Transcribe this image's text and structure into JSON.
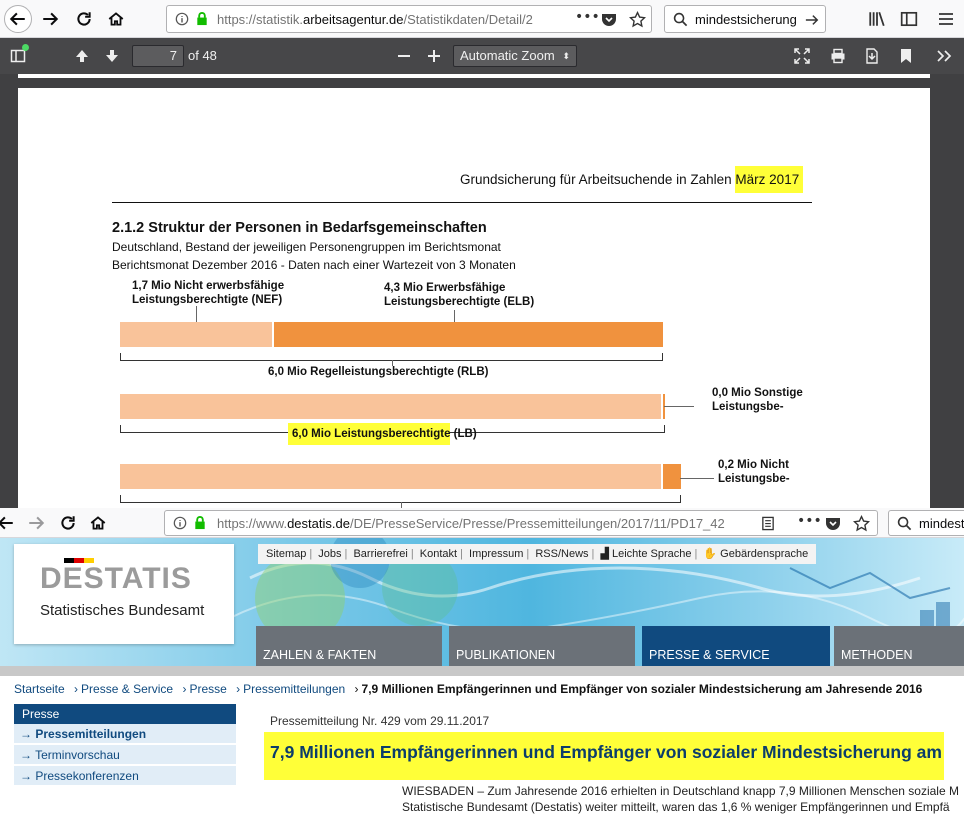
{
  "browser1": {
    "url_prefix": "https://statistik.",
    "url_domain": "arbeitsagentur.de",
    "url_path": "/Statistikdaten/Detail/2",
    "search_text": "mindestsicherung"
  },
  "pdf_toolbar": {
    "page_number": "7",
    "page_count": "of 48",
    "zoom": "Automatic Zoom"
  },
  "pdf": {
    "header": "Grundsicherung für Arbeitsuchende in Zahlen ",
    "header_highlight": "März 2017",
    "section_title": "2.1.2 Struktur der Personen in Bedarfsgemeinschaften",
    "subtitle1": "Deutschland, Bestand der jeweiligen Personengruppen im Berichtsmonat",
    "subtitle2": "Berichtsmonat Dezember 2016 -  Daten nach einer Wartezeit von 3 Monaten",
    "label_nef_1": "1,7 Mio Nicht erwerbsfähige",
    "label_nef_2": "Leistungsberechtigte (NEF)",
    "label_elb_1": "4,3 Mio Erwerbsfähige",
    "label_elb_2": "Leistungsberechtigte (ELB)",
    "label_rlb": "6,0 Mio Regelleistungsberechtigte (RLB)",
    "label_sonst_1": "0,0 Mio Sonstige",
    "label_sonst_2": "Leistungsbe-",
    "label_lb_highlight": "6,0 Mio Leistungsberechtigte",
    "label_lb_rest": " (LB)",
    "label_nicht_1": "0,2 Mio Nicht",
    "label_nicht_2": "Leistungsbe-"
  },
  "chart_data": [
    {
      "type": "bar",
      "title": "2.1.2 Struktur der Personen in Bedarfsgemeinschaften",
      "orientation": "horizontal-stacked",
      "rows": [
        {
          "label": "6,0 Mio Regelleistungsberechtigte (RLB)",
          "segments": [
            {
              "name": "Nicht erwerbsfähige Leistungsberechtigte (NEF)",
              "value": 1.7,
              "color": "#f9c39a"
            },
            {
              "name": "Erwerbsfähige Leistungsberechtigte (ELB)",
              "value": 4.3,
              "color": "#f0923e"
            }
          ]
        },
        {
          "label": "6,0 Mio Leistungsberechtigte (LB)",
          "segments": [
            {
              "name": "Regelleistungsberechtigte (RLB)",
              "value": 6.0,
              "color": "#f9c39a"
            },
            {
              "name": "Sonstige Leistungsberechtigte",
              "value": 0.0,
              "color": "#f0923e"
            }
          ]
        },
        {
          "label": "",
          "segments": [
            {
              "name": "Leistungsberechtigte (LB)",
              "value": 6.0,
              "color": "#f9c39a"
            },
            {
              "name": "Nicht Leistungsberechtigte",
              "value": 0.2,
              "color": "#f0923e"
            }
          ]
        }
      ],
      "unit": "Mio"
    }
  ],
  "browser2": {
    "url_prefix": "https://www.",
    "url_domain": "destatis.de",
    "url_path": "/DE/PresseService/Presse/Pressemitteilungen/2017/11/PD17_42",
    "search_text": "mindest"
  },
  "destatis": {
    "logo_main": "DESTATIS",
    "logo_sub": "Statistisches Bundesamt",
    "topnav": [
      "Sitemap",
      "Jobs",
      "Barrierefrei",
      "Kontakt",
      "Impressum",
      "RSS/News",
      "Leichte Sprache",
      "Gebärdensprache"
    ],
    "tabs": [
      "ZAHLEN & FAKTEN",
      "PUBLIKATIONEN",
      "PRESSE & SERVICE",
      "METHODEN"
    ],
    "breadcrumb": [
      "Startseite",
      "Presse & Service",
      "Presse",
      "Pressemitteilungen"
    ],
    "breadcrumb_current": "7,9 Millionen Empfängerinnen und Empfänger von sozialer Mindestsicherung am Jahresende 2016",
    "sidebar_head": "Presse",
    "sidebar_items": [
      "Pressemitteilungen",
      "Terminvorschau",
      "Pressekonferenzen"
    ],
    "pm_number": "Pressemitteilung Nr. 429 vom 29.11.2017",
    "headline": "7,9 Millionen Empfängerinnen und Empfänger von sozialer Mindestsicherung am",
    "lead1": "WIESBADEN – Zum Jahresende 2016 erhielten in Deutschland knapp 7,9 Millionen Menschen soziale M",
    "lead2": "Statistische Bundesamt (Destatis) weiter mitteilt, waren das 1,6 % weniger Empfängerinnen und Empfä"
  }
}
